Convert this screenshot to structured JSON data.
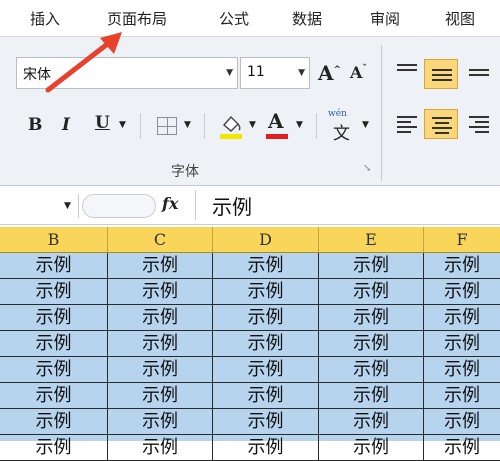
{
  "tabs": [
    "插入",
    "页面布局",
    "公式",
    "数据",
    "审阅",
    "视图"
  ],
  "font": {
    "name": "宋体",
    "size": "11"
  },
  "format_buttons": {
    "bold": "B",
    "italic": "I",
    "underline": "U",
    "font_color": "A",
    "phonetic": "wén"
  },
  "group_label": "字体",
  "formula_bar": {
    "fx": "fx",
    "value": "示例"
  },
  "columns": [
    "B",
    "C",
    "D",
    "E",
    "F"
  ],
  "cell_text": "示例",
  "rows": [
    [
      "示例",
      "示例",
      "示例",
      "示例",
      "示例"
    ],
    [
      "示例",
      "示例",
      "示例",
      "示例",
      "示例"
    ],
    [
      "示例",
      "示例",
      "示例",
      "示例",
      "示例"
    ],
    [
      "示例",
      "示例",
      "示例",
      "示例",
      "示例"
    ],
    [
      "示例",
      "示例",
      "示例",
      "示例",
      "示例"
    ],
    [
      "示例",
      "示例",
      "示例",
      "示例",
      "示例"
    ],
    [
      "示例",
      "示例",
      "示例",
      "示例",
      "示例"
    ],
    [
      "示例",
      "示例",
      "示例",
      "示例",
      "示例"
    ]
  ],
  "colors": {
    "header_fill": "#f9d55a",
    "selection_fill": "#b6d4ee",
    "arrow": "#e8412c",
    "active_align": "#fbd77c"
  }
}
